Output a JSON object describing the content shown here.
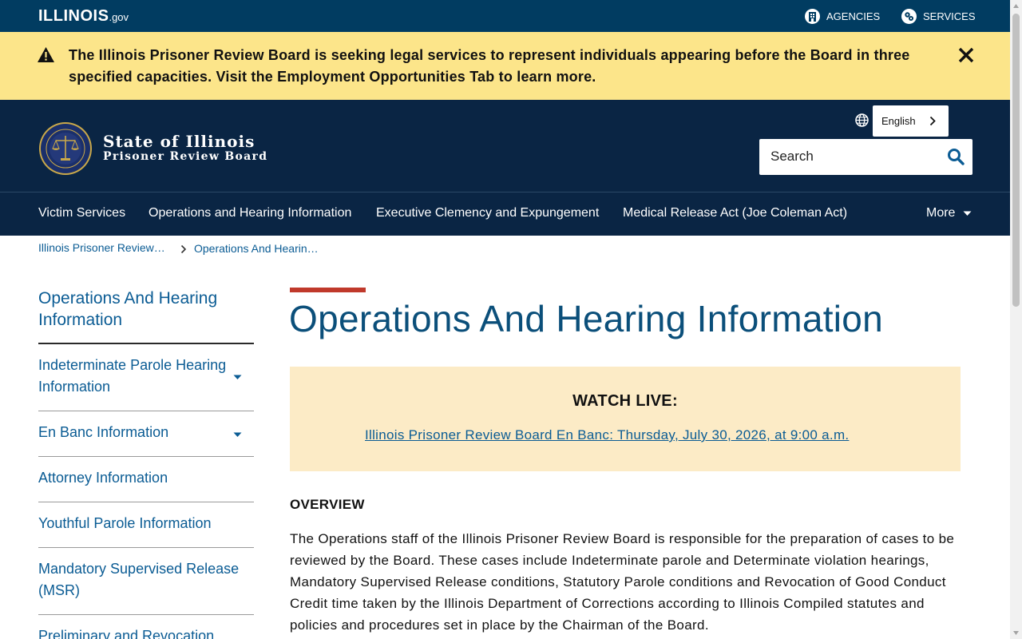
{
  "topbar": {
    "logo_main": "ILLINOIS",
    "logo_suffix": ".gov",
    "agencies_label": "AGENCIES",
    "services_label": "SERVICES"
  },
  "alert": {
    "text": "The Illinois Prisoner Review Board is seeking legal services to represent individuals appearing before the Board in three specified capacities.  Visit the Employment Opportunities Tab to learn more.",
    "close_icon": "close-icon"
  },
  "header": {
    "brand_line1": "State of Illinois",
    "brand_line2": "Prisoner Review Board",
    "language_label": "English",
    "search_placeholder": "Search"
  },
  "nav": {
    "items": [
      {
        "label": "Victim Services"
      },
      {
        "label": "Operations and Hearing Information"
      },
      {
        "label": "Executive Clemency and Expungement"
      },
      {
        "label": "Medical Release Act (Joe Coleman Act)"
      }
    ],
    "more_label": "More"
  },
  "breadcrumb": {
    "items": [
      {
        "label": "Illinois Prisoner Review…"
      },
      {
        "label": "Operations And Hearin…"
      }
    ]
  },
  "sidebar": {
    "title": "Operations And Hearing Information",
    "items": [
      {
        "label": "Indeterminate Parole Hearing Information",
        "expandable": true
      },
      {
        "label": "En Banc Information",
        "expandable": true
      },
      {
        "label": "Attorney Information",
        "expandable": false
      },
      {
        "label": "Youthful Parole Information",
        "expandable": false
      },
      {
        "label": "Mandatory Supervised Release (MSR)",
        "expandable": false
      },
      {
        "label": "Preliminary and Revocation",
        "expandable": false
      }
    ]
  },
  "main": {
    "title": "Operations And Hearing Information",
    "watch_title": "WATCH LIVE:",
    "watch_link": "Illinois Prisoner Review Board En Banc: Thursday, July 30, 2026, at 9:00 a.m.",
    "overview_heading": "OVERVIEW",
    "overview_text": "The Operations staff of the Illinois Prisoner Review Board is responsible for the preparation of cases to be reviewed by the Board. These cases include Indeterminate parole and Determinate violation hearings, Mandatory Supervised Release conditions, Statutory Parole conditions and Revocation of Good Conduct Credit time taken by the Illinois Department of Corrections according to Illinois Compiled statutes and policies and procedures set in place by the Chairman of the Board."
  },
  "colors": {
    "topbar": "#013c61",
    "header": "#0a2544",
    "alert_bg": "#fce58a",
    "link": "#0b5c94",
    "accent_red": "#c0392b",
    "watch_bg": "#fcebc6"
  }
}
